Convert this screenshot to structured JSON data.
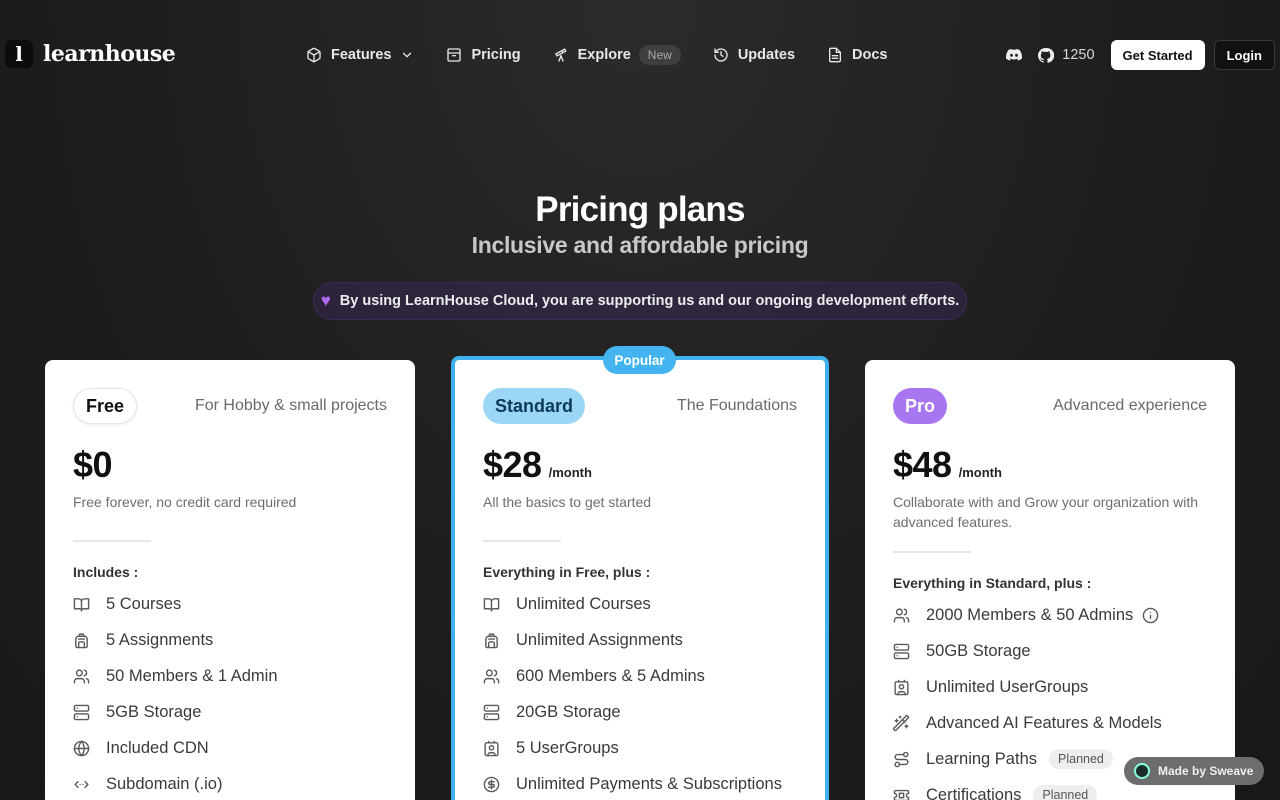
{
  "nav": {
    "logo_mark": "l",
    "logo_text": "learnhouse",
    "links": [
      {
        "label": "Features",
        "icon": "cube-icon"
      },
      {
        "label": "Pricing",
        "icon": "archive-icon"
      },
      {
        "label": "Explore",
        "icon": "telescope-icon",
        "badge": "New"
      },
      {
        "label": "Updates",
        "icon": "history-icon"
      },
      {
        "label": "Docs",
        "icon": "file-text-icon"
      }
    ],
    "github_stars": "1250",
    "get_started": "Get Started",
    "login": "Login"
  },
  "hero": {
    "title": "Pricing plans",
    "subtitle": "Inclusive and affordable pricing",
    "support_text": "By using LearnHouse Cloud, you are supporting us and our ongoing development efforts."
  },
  "plans": {
    "free": {
      "name": "Free",
      "tagline": "For Hobby & small projects",
      "price": "$0",
      "period": "",
      "description": "Free forever, no credit card required",
      "includes_label": "Includes :",
      "features": [
        {
          "label": "5 Courses",
          "icon": "book-icon"
        },
        {
          "label": "5 Assignments",
          "icon": "backpack-icon"
        },
        {
          "label": "50 Members & 1 Admin",
          "icon": "users-icon"
        },
        {
          "label": "5GB Storage",
          "icon": "server-icon"
        },
        {
          "label": "Included CDN",
          "icon": "globe-icon"
        },
        {
          "label": "Subdomain (.io)",
          "icon": "code-arrows-icon"
        }
      ]
    },
    "standard": {
      "popular_label": "Popular",
      "name": "Standard",
      "tagline": "The Foundations",
      "price": "$28",
      "period": "/month",
      "description": "All the basics to get started",
      "includes_label": "Everything in Free, plus :",
      "features": [
        {
          "label": "Unlimited Courses",
          "icon": "book-icon"
        },
        {
          "label": "Unlimited Assignments",
          "icon": "backpack-icon"
        },
        {
          "label": "600 Members & 5 Admins",
          "icon": "users-icon"
        },
        {
          "label": "20GB Storage",
          "icon": "server-icon"
        },
        {
          "label": "5 UserGroups",
          "icon": "contact-icon"
        },
        {
          "label": "Unlimited Payments & Subscriptions",
          "icon": "dollar-circle-icon"
        }
      ]
    },
    "pro": {
      "name": "Pro",
      "tagline": "Advanced experience",
      "price": "$48",
      "period": "/month",
      "description": "Collaborate with and Grow your organization with advanced features.",
      "includes_label": "Everything in Standard, plus :",
      "features": [
        {
          "label": "2000 Members & 50 Admins",
          "icon": "users-icon",
          "info": true
        },
        {
          "label": "50GB Storage",
          "icon": "server-icon"
        },
        {
          "label": "Unlimited UserGroups",
          "icon": "contact-icon"
        },
        {
          "label": "Advanced AI Features & Models",
          "icon": "magic-wand-icon"
        },
        {
          "label": "Learning Paths",
          "icon": "route-icon",
          "badge": "Planned"
        },
        {
          "label": "Certifications",
          "icon": "ticket-icon",
          "badge": "Planned"
        }
      ]
    }
  },
  "sweave": {
    "label": "Made by Sweave"
  },
  "colors": {
    "accent_blue": "#3fb2ee",
    "pro_purple": "#a976f2",
    "standard_pill": "#9bd6f6"
  }
}
